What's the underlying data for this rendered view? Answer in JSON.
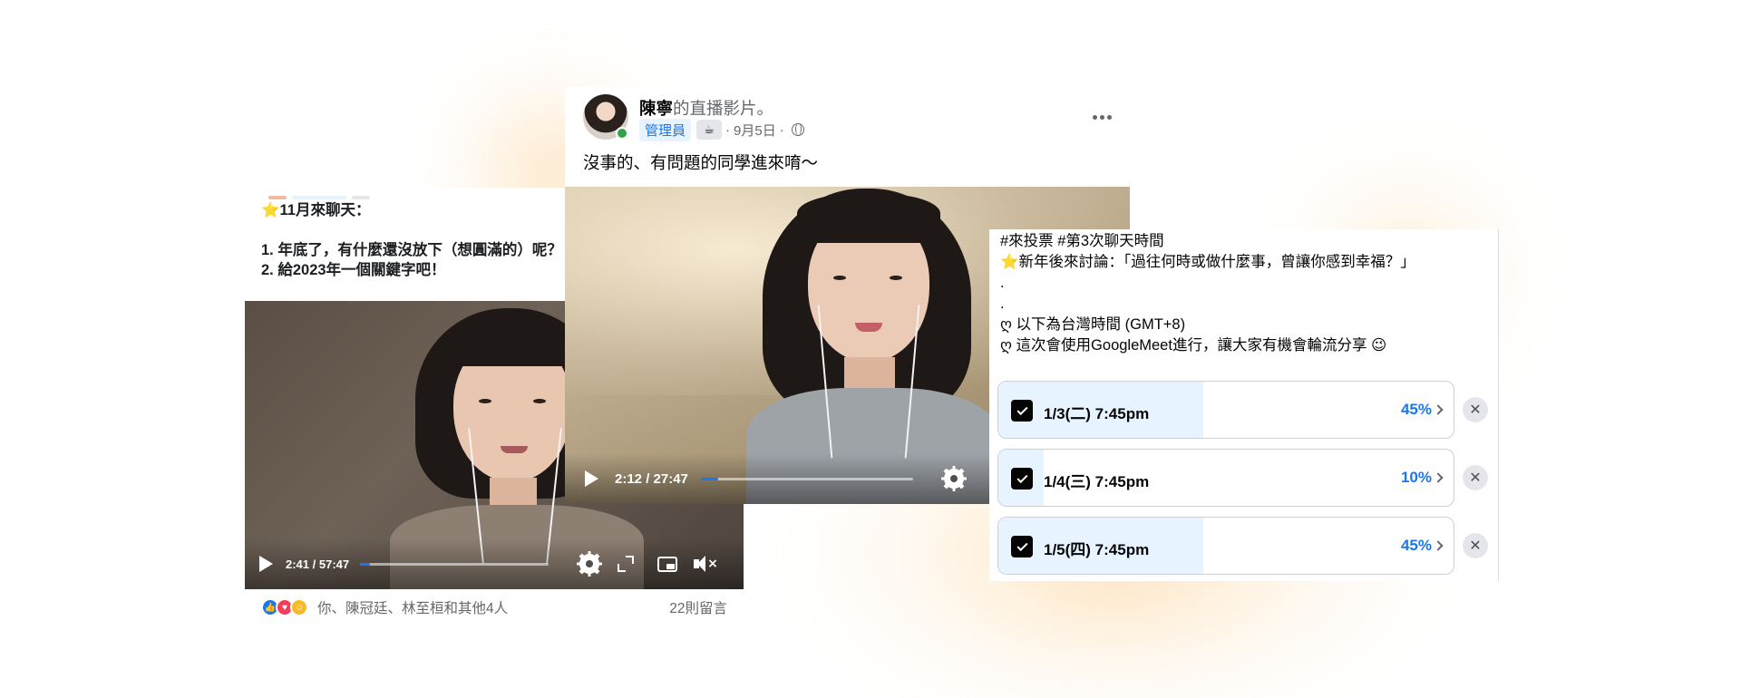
{
  "left_post": {
    "lines": [
      "⭐11月來聊天：",
      "1. 年底了，有什麼還沒放下（想圓滿的）呢？",
      "2. 給2023年一個關鍵字吧！"
    ],
    "video": {
      "time": "2:41 / 57:47",
      "progress": 0.05
    },
    "reactions": {
      "icons": [
        "like-icon",
        "love-icon",
        "care-icon"
      ],
      "names": "你、陳冠廷、林至桓和其他4人",
      "comments": "22則留言"
    }
  },
  "center_post": {
    "author": "陳寧",
    "author_suffix": "的直播影片。",
    "admin_badge": "管理員",
    "badge_icon": "coffee-cup-icon",
    "date": "9月5日",
    "audience_icon": "globe-icon",
    "text": "沒事的、有問題的同學進來唷～",
    "video": {
      "time": "2:12 / 27:47",
      "progress": 0.08
    }
  },
  "poll_post": {
    "lines": [
      "#來投票 #第3次聊天時間",
      "⭐新年後來討論：「過往何時或做什麼事，曾讓你感到幸福？」",
      ".",
      ".",
      "ღ 以下為台灣時間 (GMT+8)",
      "ღ 這次會使用GoogleMeet進行，讓大家有機會輪流分享 😉"
    ],
    "options": [
      {
        "label": "1/3(二) 7:45pm",
        "percent": "45%",
        "fraction": 0.45,
        "checked": true
      },
      {
        "label": "1/4(三) 7:45pm",
        "percent": "10%",
        "fraction": 0.1,
        "checked": true
      },
      {
        "label": "1/5(四) 7:45pm",
        "percent": "45%",
        "fraction": 0.45,
        "checked": true
      }
    ]
  },
  "colors": {
    "accent": "#1877f2",
    "poll_fill": "#e7f3ff",
    "glow": "#fcc478"
  }
}
